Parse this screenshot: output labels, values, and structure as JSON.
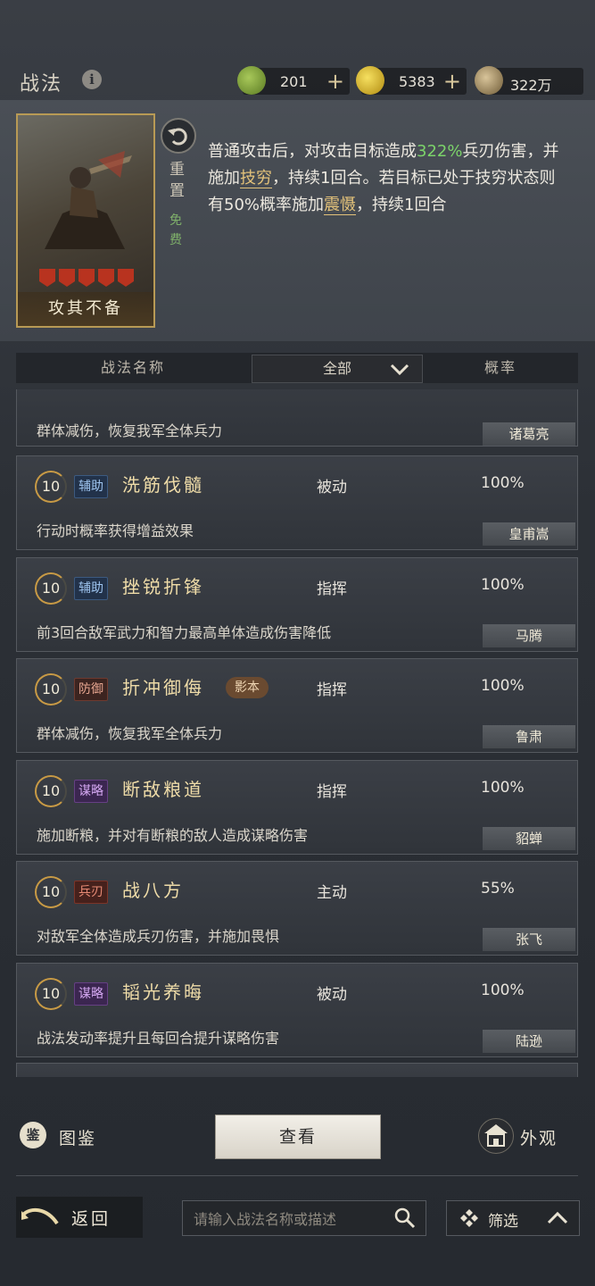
{
  "header": {
    "title": "战法",
    "info_icon": "info-icon",
    "resources": [
      {
        "icon": "jade-coin-icon",
        "value": "201",
        "has_plus": true,
        "color": "#7a9a3a"
      },
      {
        "icon": "gold-coin-icon",
        "value": "5383",
        "has_plus": true,
        "color": "#d8b020"
      },
      {
        "icon": "copper-coin-icon",
        "value": "322万",
        "has_plus": false,
        "color": "#a8906a"
      }
    ],
    "plus_symbol": "+"
  },
  "skill_detail": {
    "card_name": "攻其不备",
    "reset_label": "重置",
    "free_label": "免费",
    "description": {
      "p1": "普通攻击后，对攻击目标造成",
      "pct": "322%",
      "p2": "兵刃伤害，并施加",
      "kw1": "技穷",
      "p3": "，持续1回合。若目标已处于技穷状态则有50%概率施加",
      "kw2": "震慑",
      "p4": "，持续1回合"
    }
  },
  "filter_bar": {
    "col_name": "战法名称",
    "dropdown_value": "全部",
    "col_rate": "概率"
  },
  "list": {
    "partial_item": {
      "desc": "群体减伤，恢复我军全体兵力",
      "general": "诸葛亮"
    },
    "items": [
      {
        "level": "10",
        "tag": "辅助",
        "tag_type": "fz",
        "name": "洗筋伐髓",
        "badge": "",
        "type": "被动",
        "rate": "100%",
        "desc": "行动时概率获得增益效果",
        "general": "皇甫嵩"
      },
      {
        "level": "10",
        "tag": "辅助",
        "tag_type": "fz",
        "name": "挫锐折锋",
        "badge": "",
        "type": "指挥",
        "rate": "100%",
        "desc": "前3回合敌军武力和智力最高单体造成伤害降低",
        "general": "马腾"
      },
      {
        "level": "10",
        "tag": "防御",
        "tag_type": "fy",
        "name": "折冲御侮",
        "badge": "影本",
        "type": "指挥",
        "rate": "100%",
        "desc": "群体减伤，恢复我军全体兵力",
        "general": "鲁肃"
      },
      {
        "level": "10",
        "tag": "谋略",
        "tag_type": "ml",
        "name": "断敌粮道",
        "badge": "",
        "type": "指挥",
        "rate": "100%",
        "desc": "施加断粮，并对有断粮的敌人造成谋略伤害",
        "general": "貂蝉"
      },
      {
        "level": "10",
        "tag": "兵刃",
        "tag_type": "by",
        "name": "战八方",
        "badge": "",
        "type": "主动",
        "rate": "55%",
        "desc": "对敌军全体造成兵刃伤害，并施加畏惧",
        "general": "张飞"
      },
      {
        "level": "10",
        "tag": "谋略",
        "tag_type": "ml",
        "name": "韬光养晦",
        "badge": "",
        "type": "被动",
        "rate": "100%",
        "desc": "战法发动率提升且每回合提升谋略伤害",
        "general": "陆逊"
      }
    ]
  },
  "footer": {
    "atlas_icon_char": "鉴",
    "atlas_label": "图鉴",
    "view_label": "查看",
    "appearance_label": "外观",
    "back_label": "返回",
    "search_placeholder": "请输入战法名称或描述",
    "filter_label": "筛选"
  }
}
